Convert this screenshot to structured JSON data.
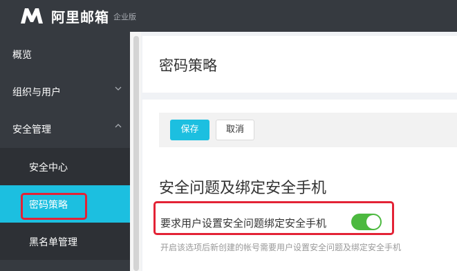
{
  "brand": {
    "name": "阿里邮箱",
    "edition": "企业版",
    "logo_icon": "m-logo-icon"
  },
  "sidebar": {
    "items": [
      {
        "label": "概览"
      },
      {
        "label": "组织与用户",
        "icon": "chevron-down-icon"
      },
      {
        "label": "安全管理",
        "icon": "chevron-up-icon"
      }
    ],
    "sub_items": [
      {
        "label": "安全中心"
      },
      {
        "label": "密码策略",
        "active": true
      },
      {
        "label": "黑名单管理"
      }
    ]
  },
  "header": {
    "title": "密码策略"
  },
  "toolbar": {
    "save_label": "保存",
    "cancel_label": "取消"
  },
  "section": {
    "title": "安全问题及绑定安全手机",
    "setting_label": "要求用户设置安全问题绑定安全手机",
    "setting_enabled": true,
    "setting_desc": "开启该选项后新创建的帐号需要用户设置安全问题及绑定安全手机"
  },
  "colors": {
    "sidebar_bg": "#363a40",
    "accent": "#1cbfe0",
    "toggle_on": "#4cb93f",
    "highlight": "#e32235"
  }
}
